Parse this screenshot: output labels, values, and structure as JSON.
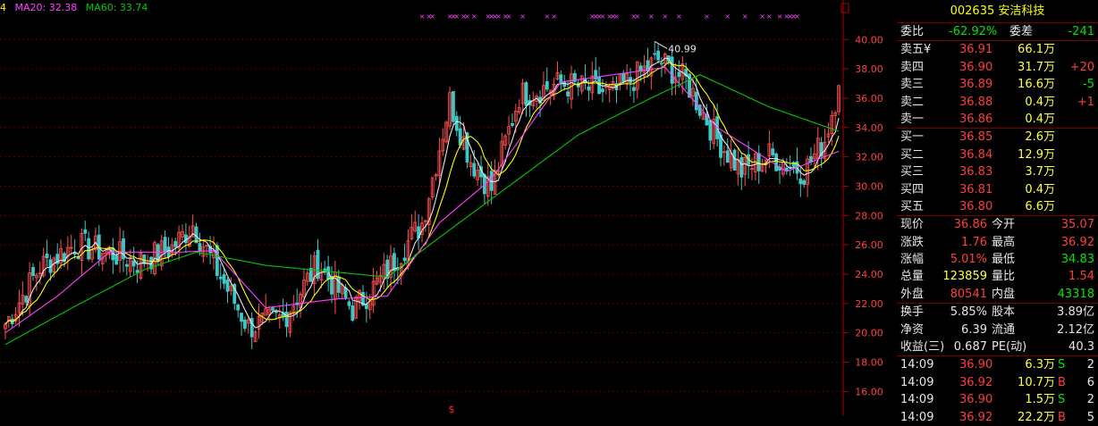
{
  "legend": {
    "ma_prefix": "4",
    "ma20_label": "MA20: 32.38",
    "ma60_label": "MA60: 33.74",
    "colors": {
      "ma5": "#e6e6e6",
      "ma10": "#ffff00",
      "ma20": "#ff40ff",
      "ma60": "#00c800",
      "up": "#ff5050",
      "down": "#3cc8c8"
    }
  },
  "chart_data": {
    "type": "candlestick",
    "y_ticks": [
      "40.00",
      "38.00",
      "36.00",
      "34.00",
      "32.00",
      "30.00",
      "28.00",
      "26.00",
      "24.00",
      "22.00",
      "20.00",
      "18.00",
      "16.00"
    ],
    "ylim": [
      14.8,
      41.6
    ],
    "max_label": "40.99",
    "bottom_marker": "$",
    "close_anchors": [
      [
        0,
        20.6
      ],
      [
        10,
        24.5
      ],
      [
        20,
        26.0
      ],
      [
        30,
        25.5
      ],
      [
        38,
        24.8
      ],
      [
        48,
        25.8
      ],
      [
        54,
        27.4
      ],
      [
        62,
        23.8
      ],
      [
        70,
        20.4
      ],
      [
        80,
        21.0
      ],
      [
        90,
        24.7
      ],
      [
        100,
        21.6
      ],
      [
        108,
        23.6
      ],
      [
        120,
        27.5
      ],
      [
        128,
        35.8
      ],
      [
        134,
        31.8
      ],
      [
        140,
        29.8
      ],
      [
        148,
        36.2
      ],
      [
        160,
        37.0
      ],
      [
        175,
        36.3
      ],
      [
        188,
        38.6
      ],
      [
        196,
        37.2
      ],
      [
        205,
        33.2
      ],
      [
        212,
        31.0
      ],
      [
        220,
        32.1
      ],
      [
        230,
        31.0
      ],
      [
        236,
        33.2
      ],
      [
        240,
        36.86
      ]
    ],
    "ma20_anchors": [
      [
        0,
        20.0
      ],
      [
        15,
        22.5
      ],
      [
        30,
        25.5
      ],
      [
        50,
        25.5
      ],
      [
        60,
        25.6
      ],
      [
        75,
        21.7
      ],
      [
        95,
        22.3
      ],
      [
        110,
        22.5
      ],
      [
        125,
        27.5
      ],
      [
        140,
        30.5
      ],
      [
        160,
        37.1
      ],
      [
        190,
        38.1
      ],
      [
        205,
        34.0
      ],
      [
        225,
        31.0
      ],
      [
        240,
        32.38
      ]
    ],
    "ma60_anchors": [
      [
        0,
        19.2
      ],
      [
        20,
        21.8
      ],
      [
        40,
        24.3
      ],
      [
        55,
        25.5
      ],
      [
        75,
        24.6
      ],
      [
        110,
        23.8
      ],
      [
        125,
        26.5
      ],
      [
        145,
        30.0
      ],
      [
        165,
        33.5
      ],
      [
        185,
        35.9
      ],
      [
        200,
        37.6
      ],
      [
        220,
        35.4
      ],
      [
        240,
        33.74
      ]
    ],
    "count": 241
  },
  "panel": {
    "title": "002635 安洁科技",
    "weibi_label": "委比",
    "weibi_value": "-62.92%",
    "weicha_label": "委差",
    "weicha_value": "-241",
    "asks": [
      {
        "label": "卖五",
        "sym": "¥",
        "price": "36.91",
        "vol": "66.1万",
        "chg": ""
      },
      {
        "label": "卖四",
        "sym": "",
        "price": "36.90",
        "vol": "31.7万",
        "chg": "+20"
      },
      {
        "label": "卖三",
        "sym": "",
        "price": "36.89",
        "vol": "16.6万",
        "chg": "-5"
      },
      {
        "label": "卖二",
        "sym": "",
        "price": "36.88",
        "vol": "0.4万",
        "chg": "+1"
      },
      {
        "label": "卖一",
        "sym": "",
        "price": "36.86",
        "vol": "0.4万",
        "chg": ""
      }
    ],
    "bids": [
      {
        "label": "买一",
        "price": "36.85",
        "vol": "2.6万"
      },
      {
        "label": "买二",
        "price": "36.84",
        "vol": "12.9万"
      },
      {
        "label": "买三",
        "price": "36.83",
        "vol": "3.7万"
      },
      {
        "label": "买四",
        "price": "36.81",
        "vol": "0.4万"
      },
      {
        "label": "买五",
        "price": "36.80",
        "vol": "6.6万"
      }
    ],
    "quote": [
      {
        "l1": "现价",
        "v1": "36.86",
        "l2": "今开",
        "v2": "35.07"
      },
      {
        "l1": "涨跌",
        "v1": "1.76",
        "l2": "最高",
        "v2": "36.92"
      },
      {
        "l1": "涨幅",
        "v1": "5.01%",
        "l2": "最低",
        "v2": "34.83"
      },
      {
        "l1": "总量",
        "v1": "123859",
        "l2": "量比",
        "v2": "1.54"
      },
      {
        "l1": "外盘",
        "v1": "80541",
        "l2": "内盘",
        "v2": "43318"
      }
    ],
    "fund": [
      {
        "l1": "换手",
        "v1": "5.85%",
        "l2": "股本",
        "v2": "3.89亿"
      },
      {
        "l1": "净资",
        "v1": "6.39",
        "l2": "流通",
        "v2": "2.12亿"
      },
      {
        "l1": "收益(三)",
        "v1": "0.687",
        "l2": "PE(动)",
        "v2": "40.3"
      }
    ],
    "ticks": [
      {
        "time": "14:09",
        "price": "36.90",
        "vol": "6.3万",
        "bs": "S",
        "n": "2"
      },
      {
        "time": "14:09",
        "price": "36.92",
        "vol": "10.7万",
        "bs": "B",
        "n": "6"
      },
      {
        "time": "14:09",
        "price": "36.90",
        "vol": "1.5万",
        "bs": "S",
        "n": "2"
      },
      {
        "time": "14:09",
        "price": "36.92",
        "vol": "22.2万",
        "bs": "B",
        "n": "5"
      }
    ]
  }
}
